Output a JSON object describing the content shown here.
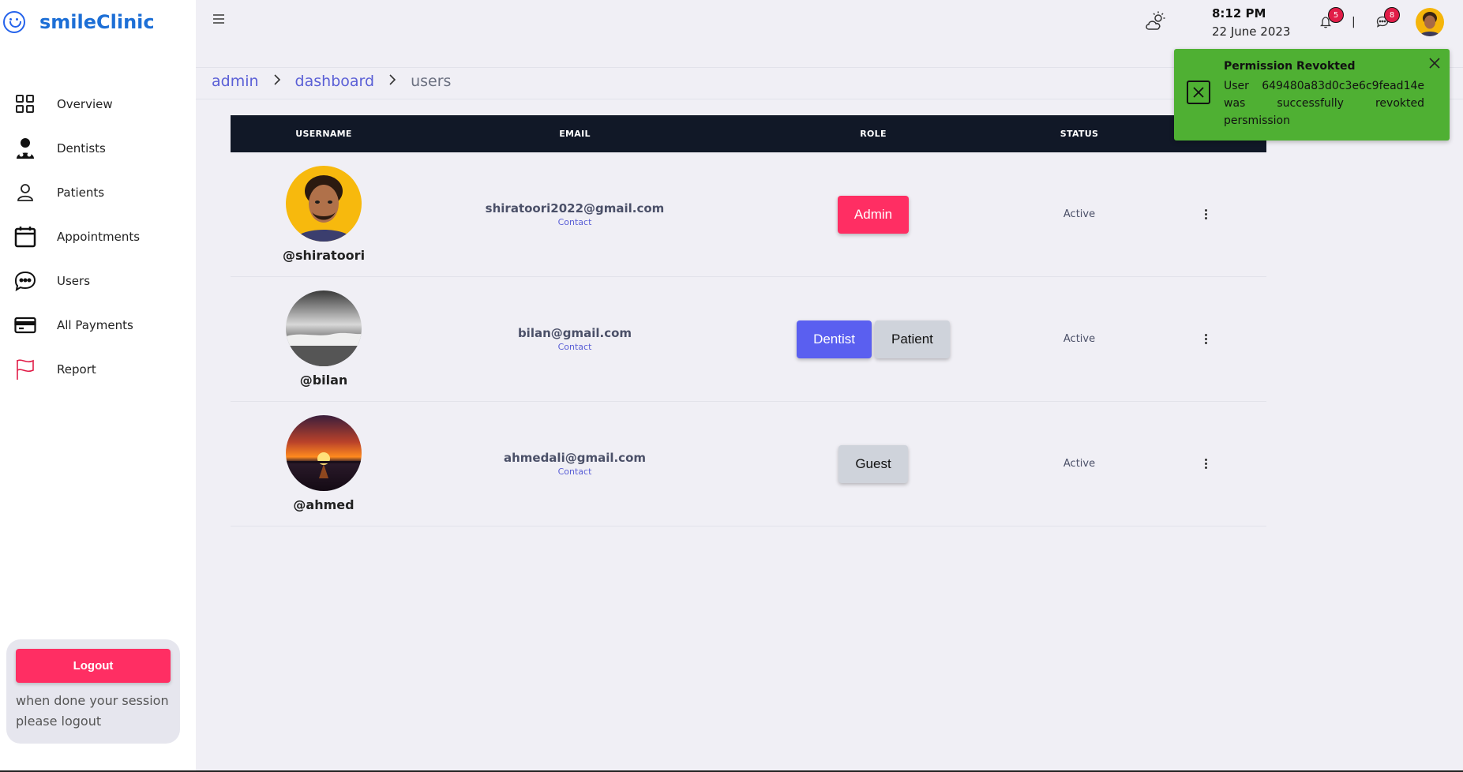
{
  "brand": {
    "name": "smileClinic",
    "logo_icon": "smiley-icon"
  },
  "sidebar": {
    "items": [
      {
        "label": "Overview",
        "icon": "grid-icon"
      },
      {
        "label": "Dentists",
        "icon": "dentist-icon"
      },
      {
        "label": "Patients",
        "icon": "person-icon"
      },
      {
        "label": "Appointments",
        "icon": "calendar-icon"
      },
      {
        "label": "Users",
        "icon": "chat-bubble-icon"
      },
      {
        "label": "All Payments",
        "icon": "credit-card-icon"
      },
      {
        "label": "Report",
        "icon": "flag-icon"
      }
    ],
    "logout_label": "Logout",
    "logout_note": "when done your session please logout"
  },
  "header": {
    "time": "8:12 PM",
    "date": "22 June 2023",
    "notifications_count": "5",
    "messages_count": "8",
    "separator": "|"
  },
  "breadcrumb": {
    "items": [
      "admin",
      "dashboard",
      "users"
    ]
  },
  "table": {
    "columns": [
      "USERNAME",
      "EMAIL",
      "ROLE",
      "STATUS"
    ],
    "contact_label": "Contact",
    "rows": [
      {
        "username": "@shiratoori",
        "email": "shiratoori2022@gmail.com",
        "roles": [
          "Admin"
        ],
        "status": "Active"
      },
      {
        "username": "@bilan",
        "email": "bilan@gmail.com",
        "roles": [
          "Dentist",
          "Patient"
        ],
        "status": "Active"
      },
      {
        "username": "@ahmed",
        "email": "ahmedali@gmail.com",
        "roles": [
          "Guest"
        ],
        "status": "Active"
      }
    ]
  },
  "toast": {
    "title": "Permission Revokted",
    "message": "User 649480a83d0c3e6c9fead14e was successfully revokted persmission",
    "color": "#4fb033"
  },
  "colors": {
    "accent": "#ff2e63",
    "brand": "#1d6fd6",
    "link": "#5a5fd6",
    "table_header": "#111827"
  }
}
